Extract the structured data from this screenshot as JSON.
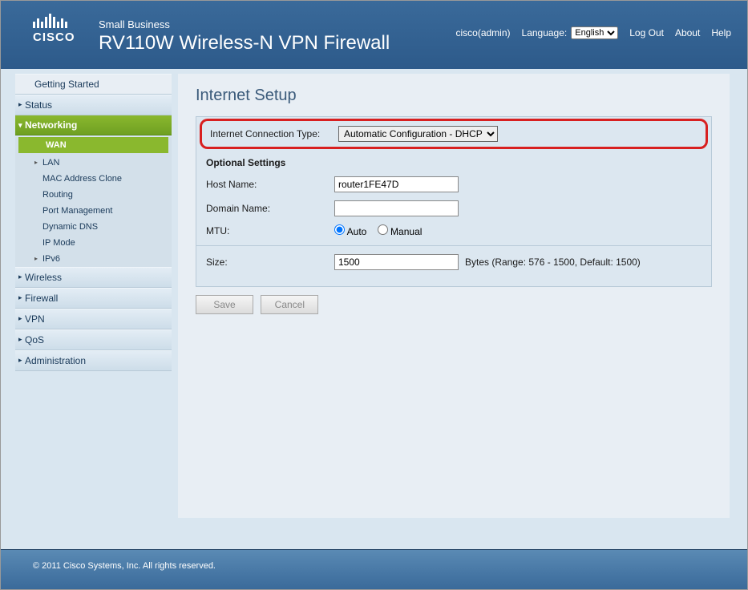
{
  "header": {
    "brand_small": "Small Business",
    "logo_text": "CISCO",
    "product": "RV110W Wireless-N VPN Firewall",
    "user_label": "cisco(admin)",
    "language_label": "Language:",
    "language_value": "English",
    "logout": "Log Out",
    "about": "About",
    "help": "Help"
  },
  "nav": {
    "getting_started": "Getting Started",
    "status": "Status",
    "networking": "Networking",
    "wireless": "Wireless",
    "firewall": "Firewall",
    "vpn": "VPN",
    "qos": "QoS",
    "administration": "Administration",
    "sub": {
      "wan": "WAN",
      "lan": "LAN",
      "mac_clone": "MAC Address Clone",
      "routing": "Routing",
      "port_mgmt": "Port Management",
      "ddns": "Dynamic DNS",
      "ip_mode": "IP Mode",
      "ipv6": "IPv6"
    }
  },
  "page": {
    "title": "Internet Setup",
    "conn_type_label": "Internet Connection Type:",
    "conn_type_value": "Automatic Configuration - DHCP",
    "optional_header": "Optional Settings",
    "host_label": "Host Name:",
    "host_value": "router1FE47D",
    "domain_label": "Domain Name:",
    "domain_value": "",
    "mtu_label": "MTU:",
    "mtu_auto": "Auto",
    "mtu_manual": "Manual",
    "size_label": "Size:",
    "size_value": "1500",
    "size_hint": "Bytes (Range: 576 - 1500, Default: 1500)",
    "save": "Save",
    "cancel": "Cancel"
  },
  "footer": {
    "copyright": "© 2011 Cisco Systems, Inc. All rights reserved."
  }
}
